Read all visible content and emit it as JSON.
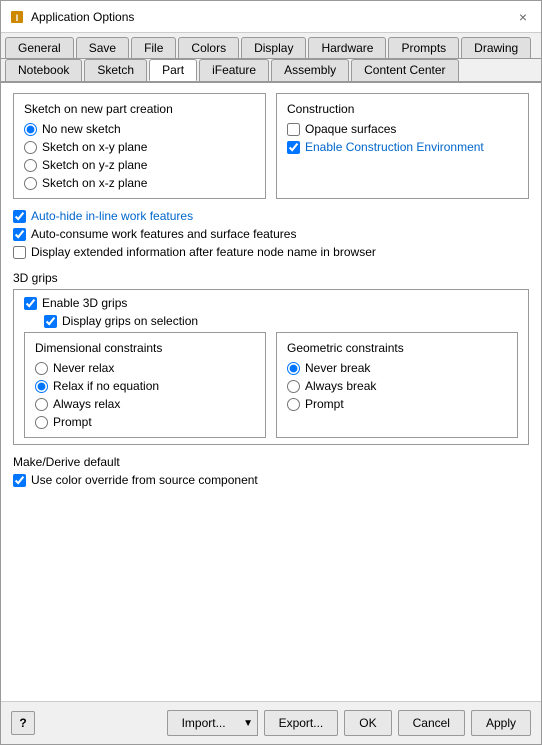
{
  "window": {
    "title": "Application Options",
    "close_label": "×"
  },
  "tabs_row1": [
    {
      "label": "General",
      "active": false
    },
    {
      "label": "Save",
      "active": false
    },
    {
      "label": "File",
      "active": false
    },
    {
      "label": "Colors",
      "active": false
    },
    {
      "label": "Display",
      "active": false
    },
    {
      "label": "Hardware",
      "active": false
    },
    {
      "label": "Prompts",
      "active": false
    },
    {
      "label": "Drawing",
      "active": false
    }
  ],
  "tabs_row2": [
    {
      "label": "Notebook",
      "active": false
    },
    {
      "label": "Sketch",
      "active": false
    },
    {
      "label": "Part",
      "active": true
    },
    {
      "label": "iFeature",
      "active": false
    },
    {
      "label": "Assembly",
      "active": false
    },
    {
      "label": "Content Center",
      "active": false
    }
  ],
  "sketch_section": {
    "title": "Sketch on new part creation",
    "options": [
      {
        "label": "No new sketch",
        "checked": true
      },
      {
        "label": "Sketch on x-y plane",
        "checked": false
      },
      {
        "label": "Sketch on y-z plane",
        "checked": false
      },
      {
        "label": "Sketch on x-z plane",
        "checked": false
      }
    ]
  },
  "construction_section": {
    "title": "Construction",
    "options": [
      {
        "label": "Opaque surfaces",
        "checked": false
      },
      {
        "label": "Enable Construction Environment",
        "checked": true
      }
    ]
  },
  "feature_checkboxes": [
    {
      "label": "Auto-hide in-line work features",
      "checked": true,
      "link": true
    },
    {
      "label": "Auto-consume work features and surface features",
      "checked": true,
      "link": false
    },
    {
      "label": "Display extended information after feature node name in browser",
      "checked": false,
      "link": false
    }
  ],
  "grips": {
    "title": "3D grips",
    "enable_label": "Enable 3D grips",
    "enable_checked": true,
    "display_label": "Display grips on selection",
    "display_checked": true
  },
  "dimensional_constraints": {
    "title": "Dimensional constraints",
    "options": [
      {
        "label": "Never relax",
        "checked": false
      },
      {
        "label": "Relax if no equation",
        "checked": true
      },
      {
        "label": "Always relax",
        "checked": false
      },
      {
        "label": "Prompt",
        "checked": false
      }
    ]
  },
  "geometric_constraints": {
    "title": "Geometric constraints",
    "options": [
      {
        "label": "Never break",
        "checked": true
      },
      {
        "label": "Always break",
        "checked": false
      },
      {
        "label": "Prompt",
        "checked": false
      }
    ]
  },
  "make_derive": {
    "title": "Make/Derive default",
    "label": "Use color override from source component",
    "checked": true
  },
  "buttons": {
    "import": "Import...",
    "export": "Export...",
    "ok": "OK",
    "cancel": "Cancel",
    "apply": "Apply",
    "help": "?"
  }
}
